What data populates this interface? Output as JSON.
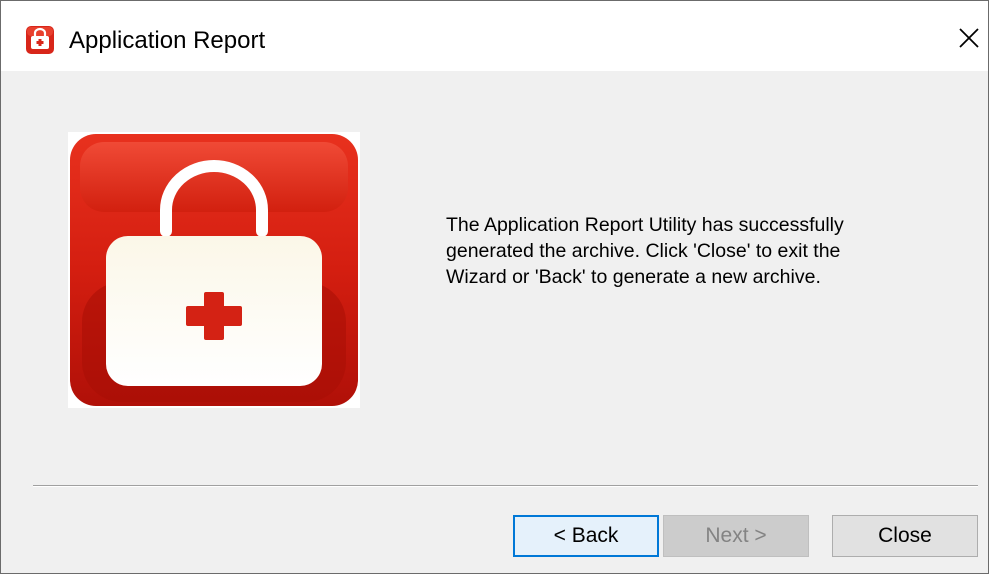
{
  "window": {
    "title": "Application Report",
    "title_icon": "first-aid-kit-icon",
    "close_icon": "close-icon"
  },
  "content": {
    "illustration_icon": "first-aid-kit-icon",
    "message": "The Application Report Utility has successfully\ngenerated the archive. Click 'Close' to exit the\nWizard or 'Back' to generate a new archive."
  },
  "buttons": {
    "back_label": "< Back",
    "next_label": "Next >",
    "close_label": "Close"
  },
  "colors": {
    "accent": "#0078d7",
    "icon_red": "#e02410",
    "dialog_background": "#f0f0f0"
  }
}
